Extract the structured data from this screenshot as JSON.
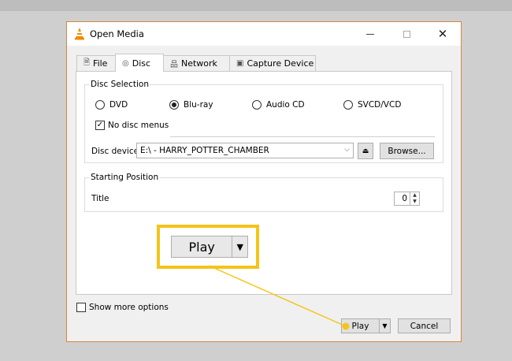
{
  "window": {
    "title": "Open Media",
    "accent_color": "#d9863a",
    "app_icon": "vlc-cone-icon"
  },
  "tabs": [
    {
      "label": "File",
      "icon": "file-icon",
      "active": false
    },
    {
      "label": "Disc",
      "icon": "disc-icon",
      "active": true
    },
    {
      "label": "Network",
      "icon": "network-icon",
      "active": false
    },
    {
      "label": "Capture Device",
      "icon": "capture-device-icon",
      "active": false
    }
  ],
  "disc_selection": {
    "group_label": "Disc Selection",
    "options": [
      {
        "label": "DVD",
        "checked": false
      },
      {
        "label": "Blu-ray",
        "checked": true
      },
      {
        "label": "Audio CD",
        "checked": false
      },
      {
        "label": "SVCD/VCD",
        "checked": false
      }
    ],
    "no_disc_menus": {
      "label": "No disc menus",
      "checked": true
    },
    "device_label": "Disc device",
    "device_value": "E:\\ - HARRY_POTTER_CHAMBER",
    "browse_label": "Browse..."
  },
  "starting_position": {
    "group_label": "Starting Position",
    "title_label": "Title",
    "title_value": "0"
  },
  "callout": {
    "play_label": "Play",
    "highlight_color": "#f4c41a"
  },
  "footer": {
    "show_more_label": "Show more options",
    "show_more_checked": false,
    "play_label": "Play",
    "cancel_label": "Cancel"
  }
}
